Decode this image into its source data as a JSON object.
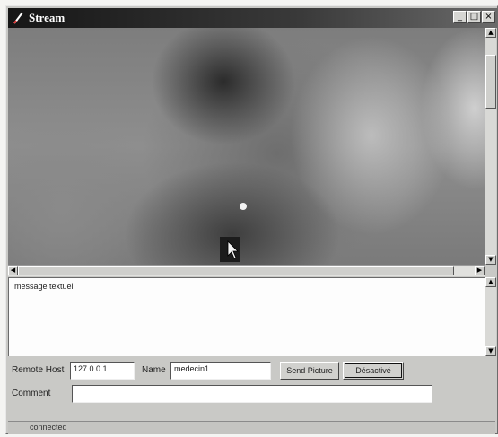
{
  "window": {
    "title": "Stream"
  },
  "titlebar": {
    "minimize": "_",
    "maximize": "□",
    "close": "×"
  },
  "message": {
    "text": "message textuel"
  },
  "form": {
    "remote_host_label": "Remote Host",
    "remote_host_value": "127.0.0.1",
    "name_label": "Name",
    "name_value": "medecin1",
    "send_picture_label": "Send Picture",
    "deactivate_label": "Désactivé",
    "comment_label": "Comment",
    "comment_value": ""
  },
  "status": {
    "text": "connected"
  },
  "icons": {
    "app": "pen-icon",
    "minimize": "minimize-icon",
    "maximize": "maximize-icon",
    "close": "close-icon",
    "cursor": "mouse-cursor-icon"
  }
}
